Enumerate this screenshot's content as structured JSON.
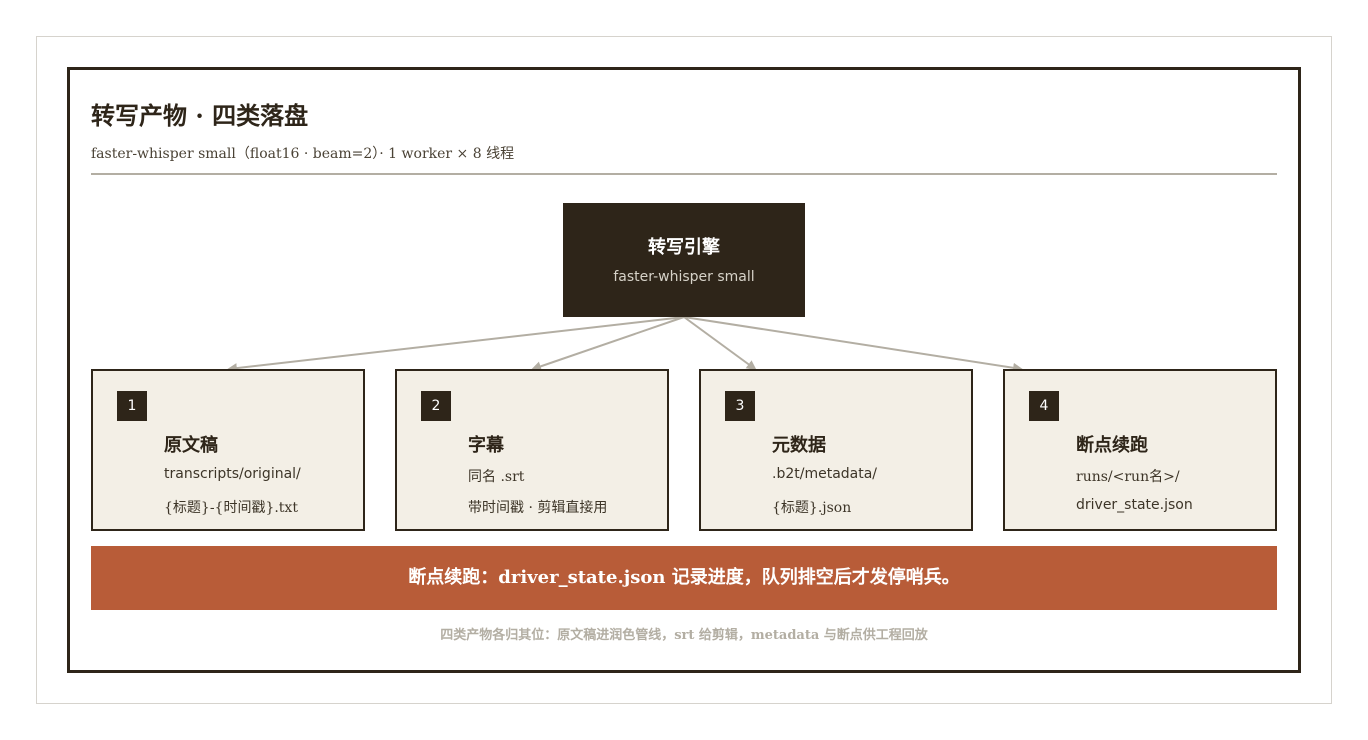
{
  "title": "转写产物 · 四类落盘",
  "subtitle": "faster-whisper small（float16 · beam=2）· 1 worker × 8 线程",
  "engine": {
    "title": "转写引擎",
    "subtitle": "faster-whisper small"
  },
  "cards": [
    {
      "num": "1",
      "title": "原文稿",
      "line1": "transcripts/original/",
      "line2": "{标题}-{时间戳}.txt"
    },
    {
      "num": "2",
      "title": "字幕",
      "line1": "同名 .srt",
      "line2": "带时间戳 · 剪辑直接用"
    },
    {
      "num": "3",
      "title": "元数据",
      "line1": ".b2t/metadata/",
      "line2": "{标题}.json"
    },
    {
      "num": "4",
      "title": "断点续跑",
      "line1": "runs/<run名>/",
      "line2": "driver_state.json"
    }
  ],
  "banner": "断点续跑：driver_state.json 记录进度，队列排空后才发停哨兵。",
  "footer": "四类产物各归其位：原文稿进润色管线，srt 给剪辑，metadata 与断点供工程回放",
  "colors": {
    "dark": "#2e2519",
    "card_bg": "#f3efe6",
    "accent": "#b85c38",
    "arrow": "#b3aea3"
  }
}
